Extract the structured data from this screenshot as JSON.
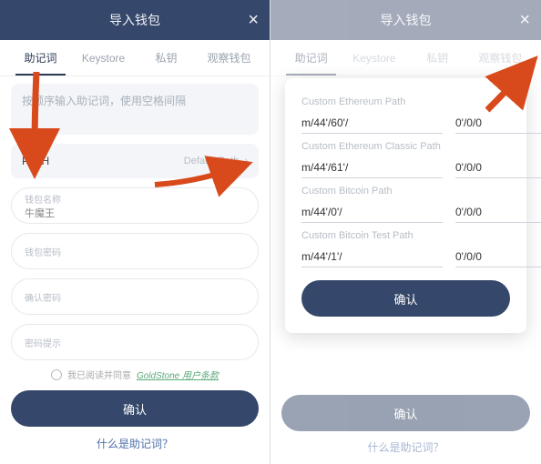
{
  "header": {
    "title": "导入钱包"
  },
  "tabs": [
    "助记词",
    "Keystore",
    "私钥",
    "观察钱包"
  ],
  "textarea_placeholder": "按顺序输入助记词，使用空格间隔",
  "path": {
    "label": "PATH",
    "right": "Default Path"
  },
  "fields": {
    "wallet_name_label": "钱包名称",
    "wallet_name_value": "牛魔王",
    "wallet_pwd_label": "钱包密码",
    "confirm_pwd_label": "确认密码",
    "pwd_hint_label": "密码提示"
  },
  "agree": {
    "pre": "我已阅读并同意",
    "link": "GoldStone 用户条款"
  },
  "buttons": {
    "confirm": "确认"
  },
  "bottom_link": "什么是助记词？",
  "modal": {
    "sections": [
      {
        "title": "Custom Ethereum Path",
        "left": "m/44'/60'/",
        "right": "0'/0/0"
      },
      {
        "title": "Custom Ethereum Classic Path",
        "left": "m/44'/61'/",
        "right": "0'/0/0"
      },
      {
        "title": "Custom Bitcoin Path",
        "left": "m/44'/0'/",
        "right": "0'/0/0"
      },
      {
        "title": "Custom Bitcoin Test Path",
        "left": "m/44'/1'/",
        "right": "0'/0/0"
      }
    ],
    "confirm": "确认"
  }
}
